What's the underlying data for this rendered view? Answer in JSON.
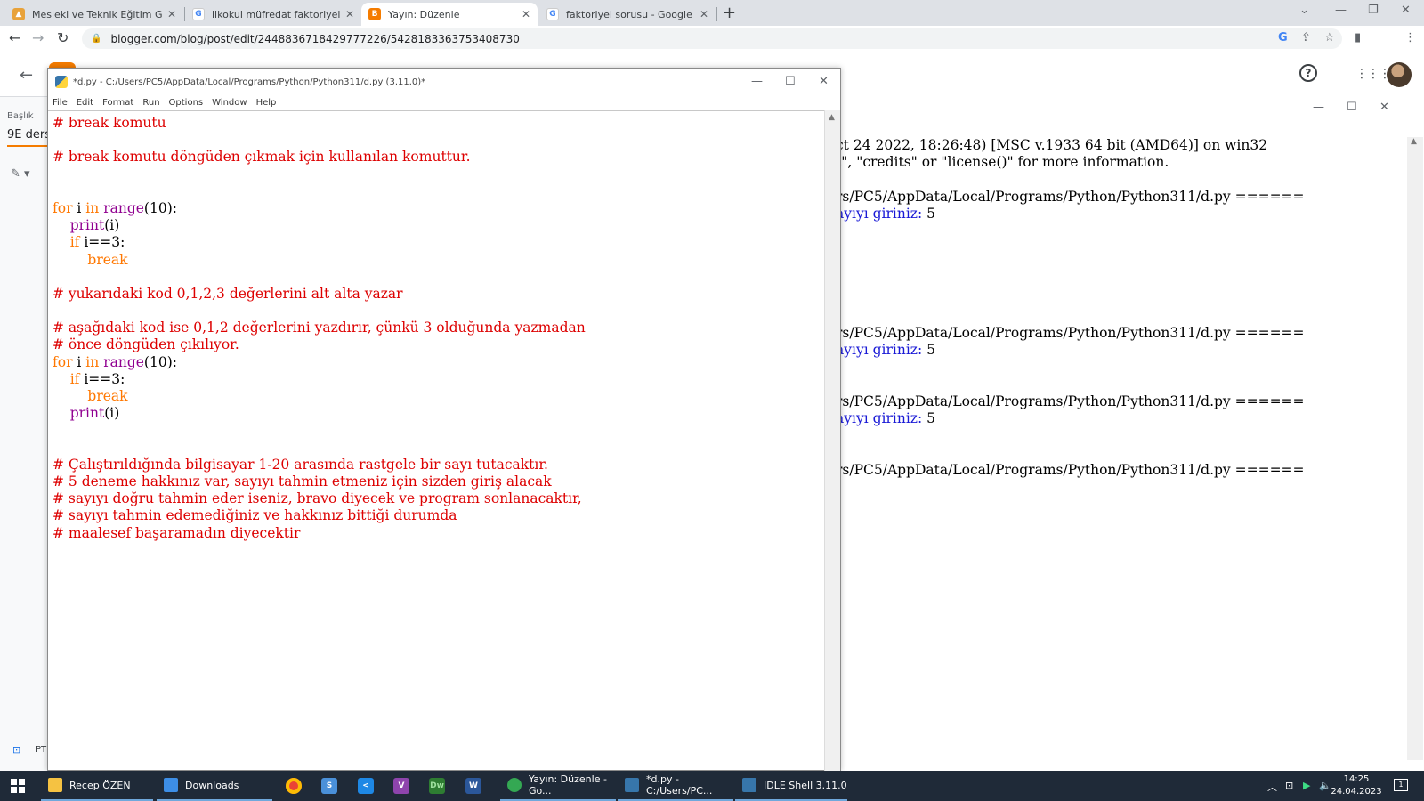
{
  "browser": {
    "tabs": [
      {
        "label": "Mesleki ve Teknik Eğitim Genel Müdürlüğü",
        "favicon": "meb-icon",
        "active": false
      },
      {
        "label": "ilkokul müfredat faktoriyel konusu",
        "favicon": "google-icon",
        "active": false
      },
      {
        "label": "Yayın: Düzenle",
        "favicon": "blogger-icon",
        "active": true
      },
      {
        "label": "faktoriyel sorusu - Google Arama",
        "favicon": "google-icon",
        "active": false
      }
    ],
    "url": "blogger.com/blog/post/edit/2448836718429777226/5428183363753408730"
  },
  "blogger": {
    "title_label": "Başlık",
    "title_value": "9E ders",
    "bottom_text": "PT",
    "accent": "#f57c00"
  },
  "editor": {
    "title": "*d.py - C:/Users/PC5/AppData/Local/Programs/Python/Python311/d.py (3.11.0)*",
    "menu": [
      "File",
      "Edit",
      "Format",
      "Run",
      "Options",
      "Window",
      "Help"
    ],
    "code_lines": [
      [
        [
          "c",
          "# break komutu"
        ]
      ],
      [],
      [
        [
          "c",
          "# break komutu döngüden çıkmak için kullanılan komuttur."
        ]
      ],
      [],
      [],
      [
        [
          "k",
          "for"
        ],
        [
          "n",
          " i "
        ],
        [
          "k",
          "in"
        ],
        [
          "n",
          " "
        ],
        [
          "b",
          "range"
        ],
        [
          "n",
          "(10):"
        ]
      ],
      [
        [
          "n",
          "    "
        ],
        [
          "b",
          "print"
        ],
        [
          "n",
          "(i)"
        ]
      ],
      [
        [
          "n",
          "    "
        ],
        [
          "k",
          "if"
        ],
        [
          "n",
          " i==3:"
        ]
      ],
      [
        [
          "n",
          "        "
        ],
        [
          "k",
          "break"
        ]
      ],
      [],
      [
        [
          "c",
          "# yukarıdaki kod 0,1,2,3 değerlerini alt alta yazar"
        ]
      ],
      [],
      [
        [
          "c",
          "# aşağıdaki kod ise 0,1,2 değerlerini yazdırır, çünkü 3 olduğunda yazmadan"
        ]
      ],
      [
        [
          "c",
          "# önce döngüden çıkılıyor."
        ]
      ],
      [
        [
          "k",
          "for"
        ],
        [
          "n",
          " i "
        ],
        [
          "k",
          "in"
        ],
        [
          "n",
          " "
        ],
        [
          "b",
          "range"
        ],
        [
          "n",
          "(10):"
        ]
      ],
      [
        [
          "n",
          "    "
        ],
        [
          "k",
          "if"
        ],
        [
          "n",
          " i==3:"
        ]
      ],
      [
        [
          "n",
          "        "
        ],
        [
          "k",
          "break"
        ]
      ],
      [
        [
          "n",
          "    "
        ],
        [
          "b",
          "print"
        ],
        [
          "n",
          "(i)"
        ]
      ],
      [],
      [],
      [
        [
          "c",
          "# Çalıştırıldığında bilgisayar 1-20 arasında rastgele bir sayı tutacaktır."
        ]
      ],
      [
        [
          "c",
          "# 5 deneme hakkınız var, sayıyı tahmin etmeniz için sizden giriş alacak"
        ]
      ],
      [
        [
          "c",
          "# sayıyı doğru tahmin eder iseniz, bravo diyecek ve program sonlanacaktır,"
        ]
      ],
      [
        [
          "c",
          "# sayıyı tahmin edemediğiniz ve hakkınız bittiği durumda"
        ]
      ],
      [
        [
          "c",
          "# maalesef başaramadın diyecektir"
        ]
      ]
    ]
  },
  "shell": {
    "lines": [
      [
        [
          "n",
          "ct 24 2022, 18:26:48) [MSC v.1933 64 bit (AMD64)] on win32"
        ]
      ],
      [
        [
          "n",
          "t\", \"credits\" or \"license()\" for more information."
        ]
      ],
      [],
      [
        [
          "n",
          "rs/PC5/AppData/Local/Programs/Python/Python311/d.py ======"
        ]
      ],
      [
        [
          "u",
          "ayıyı giriniz: "
        ],
        [
          "n",
          "5"
        ]
      ],
      [],
      [],
      [],
      [],
      [],
      [],
      [
        [
          "n",
          "rs/PC5/AppData/Local/Programs/Python/Python311/d.py ======"
        ]
      ],
      [
        [
          "u",
          "ayıyı giriniz: "
        ],
        [
          "n",
          "5"
        ]
      ],
      [],
      [],
      [
        [
          "n",
          "rs/PC5/AppData/Local/Programs/Python/Python311/d.py ======"
        ]
      ],
      [
        [
          "u",
          "ayıyı giriniz: "
        ],
        [
          "n",
          "5"
        ]
      ],
      [],
      [],
      [
        [
          "n",
          "rs/PC5/AppData/Local/Programs/Python/Python311/d.py ======"
        ]
      ]
    ]
  },
  "taskbar": {
    "items": [
      {
        "label": "Recep ÖZEN",
        "icon": "folder-icon",
        "color": "#f5c242"
      },
      {
        "label": "Downloads",
        "icon": "download-icon",
        "color": "#3d8ee6"
      },
      {
        "label": "Yayın: Düzenle - Go...",
        "icon": "chrome-icon",
        "color": "#34a853"
      },
      {
        "label": "*d.py - C:/Users/PC...",
        "icon": "python-file-icon",
        "color": "#3776ab"
      },
      {
        "label": "IDLE Shell 3.11.0",
        "icon": "idle-shell-icon",
        "color": "#3776ab"
      }
    ],
    "pinned": [
      {
        "name": "chrome-app",
        "label": "",
        "color": "#ea4335"
      },
      {
        "name": "word-app-s",
        "label": "S",
        "color": "#4a90d9"
      },
      {
        "name": "vscode-app",
        "label": "<",
        "color": "#1e88e5"
      },
      {
        "name": "visual-studio-app",
        "label": "V",
        "color": "#8e44ad"
      },
      {
        "name": "dreamweaver-app",
        "label": "Dw",
        "color": "#2e7d32"
      },
      {
        "name": "word-app",
        "label": "W",
        "color": "#2b579a"
      }
    ],
    "time": "14:25",
    "date": "24.04.2023",
    "notifications": "1"
  }
}
